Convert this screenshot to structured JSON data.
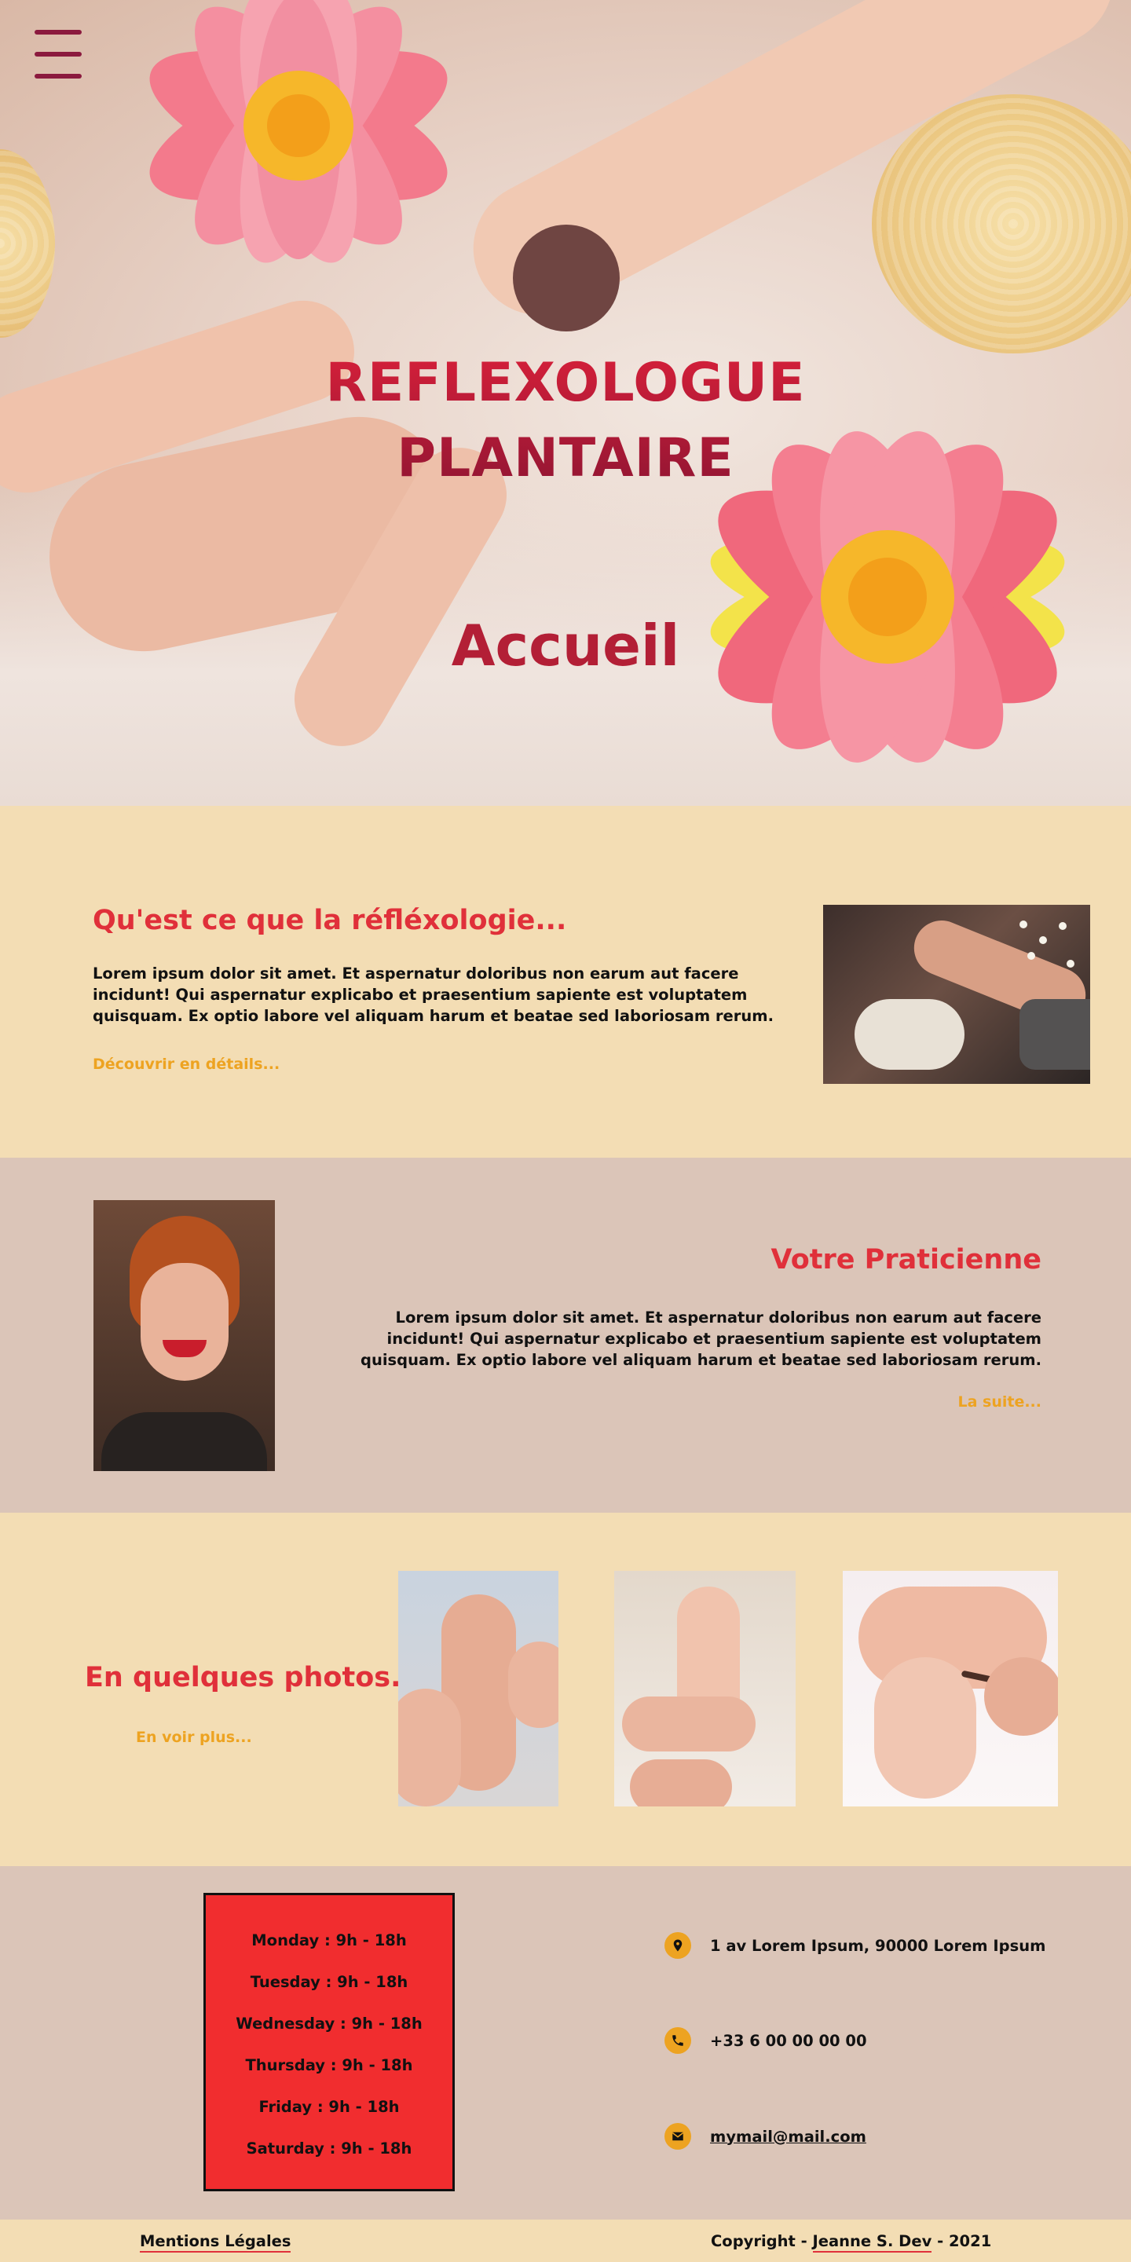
{
  "hero": {
    "title_line1": "REFLEXOLOGUE",
    "title_line2": "PLANTAIRE",
    "subtitle": "Accueil",
    "menu_icon": "hamburger-menu-icon",
    "logo_circle_color": "#6f4542",
    "title_colors": [
      "#d8203a",
      "#8f1533"
    ]
  },
  "about": {
    "title": "Qu'est ce que la réfléxologie...",
    "text": "Lorem ipsum dolor sit amet. Et aspernatur doloribus non earum aut facere incidunt! Qui aspernatur explicabo et praesentium sapiente est voluptatem quisquam. Ex optio labore vel aliquam harum et beatae sed laboriosam rerum.",
    "link": "Découvrir en détails..."
  },
  "praticienne": {
    "title": "Votre Praticienne",
    "text": "Lorem ipsum dolor sit amet. Et aspernatur doloribus non earum aut facere incidunt! Qui aspernatur explicabo et praesentium sapiente est voluptatem quisquam. Ex optio labore vel aliquam harum et beatae sed laboriosam rerum.",
    "link": "La suite..."
  },
  "photos": {
    "title": "En quelques photos...",
    "link": "En voir plus..."
  },
  "hours": [
    "Monday : 9h - 18h",
    "Tuesday : 9h - 18h",
    "Wednesday : 9h - 18h",
    "Thursday : 9h - 18h",
    "Friday : 9h - 18h",
    "Saturday : 9h - 18h"
  ],
  "contact": {
    "address": "1 av Lorem Ipsum, 90000 Lorem Ipsum",
    "phone": "+33 6 00 00 00 00",
    "email": "mymail@mail.com",
    "icons": [
      "location-pin-icon",
      "phone-icon",
      "mail-icon"
    ]
  },
  "footer": {
    "legal": "Mentions Légales",
    "copyright_prefix": "Copyright - ",
    "author": "Jeanne S. Dev",
    "copyright_suffix": " - 2021"
  },
  "colors": {
    "accent_red": "#e0303a",
    "accent_orange": "#eda321",
    "cream": "#f3ddb4",
    "taupe": "#dbc5b8",
    "hours_box": "#f12d2f"
  }
}
